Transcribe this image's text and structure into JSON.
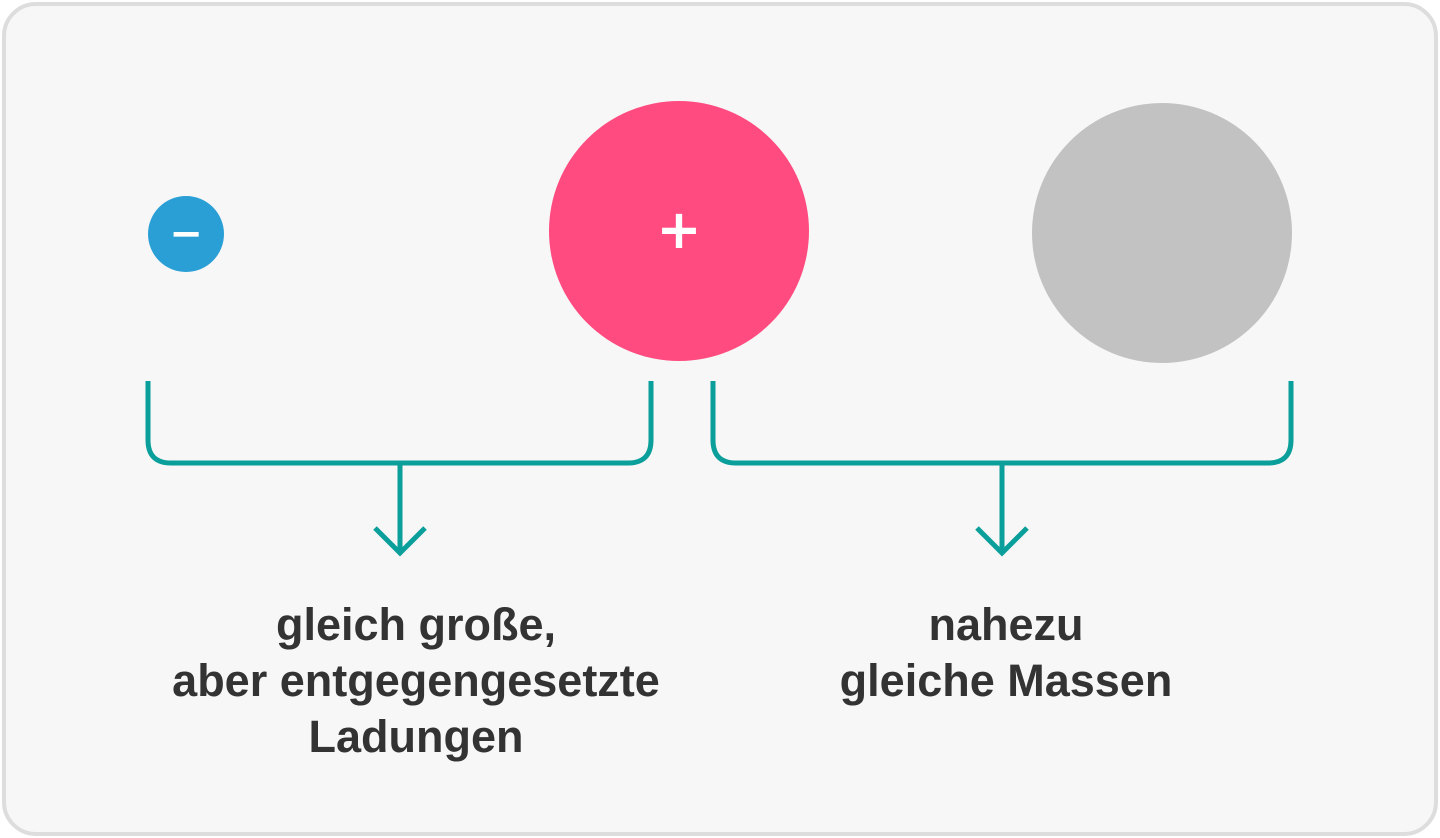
{
  "particles": [
    {
      "name": "electron",
      "sign": "−",
      "color": "#2a9fd6"
    },
    {
      "name": "proton",
      "sign": "+",
      "color": "#ff4b80"
    },
    {
      "name": "neutron",
      "sign": "",
      "color": "#c2c2c2"
    }
  ],
  "brackets": {
    "color": "#0a9f9a"
  },
  "captions": {
    "left": [
      "gleich große,",
      "aber entgegengesetzte",
      "Ladungen"
    ],
    "right": [
      "nahezu",
      "gleiche Massen"
    ]
  }
}
